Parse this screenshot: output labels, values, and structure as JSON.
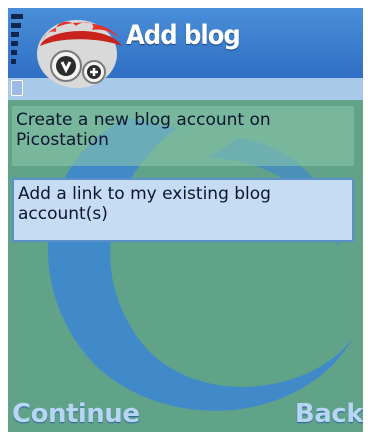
{
  "screen": {
    "title": "Add blog",
    "logo_icon": "red-mascot-head-icon",
    "signal_icon": "signal-strength-icon"
  },
  "options": [
    {
      "label": "Create a new blog account on Picostation",
      "selected": false
    },
    {
      "label": "Add a link to my existing blog account(s)",
      "selected": true
    }
  ],
  "softkeys": {
    "left": "Continue",
    "right": "Back"
  },
  "colors": {
    "background": "#61a389",
    "header": "#3f82d0",
    "selection": "#c5dcf2",
    "softkey_text": "#b7d6f3"
  }
}
